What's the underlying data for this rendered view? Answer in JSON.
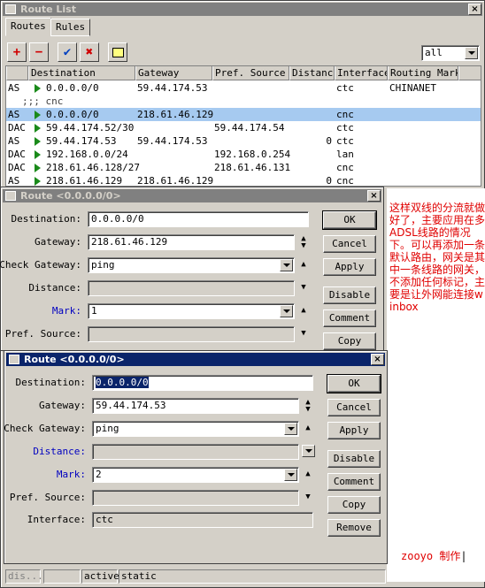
{
  "route_list": {
    "title": "Route List",
    "tabs": [
      "Routes",
      "Rules"
    ],
    "filter": "all",
    "columns": [
      "Destination",
      "Gateway",
      "Pref. Source",
      "Distance",
      "Interface",
      "Routing Mark"
    ],
    "rows": [
      {
        "flags": "AS",
        "active": true,
        "destination": "0.0.0.0/0",
        "gateway": "59.44.174.53",
        "pref_source": "",
        "distance": "",
        "interface": "ctc",
        "mark": "CHINANET",
        "selected": false
      },
      {
        "flags": "",
        "active": false,
        "destination": ";;; cnc",
        "gateway": "",
        "pref_source": "",
        "distance": "",
        "interface": "",
        "mark": "",
        "selected": false,
        "comment": true
      },
      {
        "flags": "AS",
        "active": true,
        "destination": "0.0.0.0/0",
        "gateway": "218.61.46.129",
        "pref_source": "",
        "distance": "",
        "interface": "cnc",
        "mark": "",
        "selected": true
      },
      {
        "flags": "DAC",
        "active": true,
        "destination": "59.44.174.52/30",
        "gateway": "",
        "pref_source": "59.44.174.54",
        "distance": "",
        "interface": "ctc",
        "mark": "",
        "selected": false
      },
      {
        "flags": "AS",
        "active": true,
        "destination": "59.44.174.53",
        "gateway": "59.44.174.53",
        "pref_source": "",
        "distance": "0",
        "interface": "ctc",
        "mark": "",
        "selected": false
      },
      {
        "flags": "DAC",
        "active": true,
        "destination": "192.168.0.0/24",
        "gateway": "",
        "pref_source": "192.168.0.254",
        "distance": "",
        "interface": "lan",
        "mark": "",
        "selected": false
      },
      {
        "flags": "DAC",
        "active": true,
        "destination": "218.61.46.128/27",
        "gateway": "",
        "pref_source": "218.61.46.131",
        "distance": "",
        "interface": "cnc",
        "mark": "",
        "selected": false
      },
      {
        "flags": "AS",
        "active": true,
        "destination": "218.61.46.129",
        "gateway": "218.61.46.129",
        "pref_source": "",
        "distance": "0",
        "interface": "cnc",
        "mark": "",
        "selected": false
      }
    ]
  },
  "route1": {
    "title": "Route <0.0.0.0/0>",
    "labels": {
      "destination": "Destination:",
      "gateway": "Gateway:",
      "check_gateway": "Check Gateway:",
      "distance": "Distance:",
      "mark": "Mark:",
      "pref_source": "Pref. Source:"
    },
    "destination": "0.0.0.0/0",
    "gateway": "218.61.46.129",
    "check_gateway": "ping",
    "distance": "",
    "mark": "1",
    "pref_source": "",
    "buttons": [
      "OK",
      "Cancel",
      "Apply",
      "Disable",
      "Comment",
      "Copy"
    ]
  },
  "route2": {
    "title": "Route <0.0.0.0/0>",
    "labels": {
      "destination": "Destination:",
      "gateway": "Gateway:",
      "check_gateway": "Check Gateway:",
      "distance": "Distance:",
      "mark": "Mark:",
      "pref_source": "Pref. Source:",
      "interface": "Interface:"
    },
    "destination": "0.0.0.0/0",
    "gateway": "59.44.174.53",
    "check_gateway": "ping",
    "distance": "",
    "mark": "2",
    "pref_source": "",
    "interface": "ctc",
    "buttons": [
      "OK",
      "Cancel",
      "Apply",
      "Disable",
      "Comment",
      "Copy",
      "Remove"
    ]
  },
  "status": {
    "left": "dis...",
    "mid": "",
    "active": "active",
    "static": "static"
  },
  "annotation": "这样双线的分流就做好了，主要应用在多ADSL线路的情况下。可以再添加一条默认路由，网关是其中一条线路的网关，不添加任何标记，主要是让外网能连接winbox",
  "author": "zooyo 制作",
  "colors": {
    "titlebar_active": "#0a246a",
    "titlebar_inactive": "#808080",
    "selection": "#a6caf0",
    "note": "#e00000"
  }
}
